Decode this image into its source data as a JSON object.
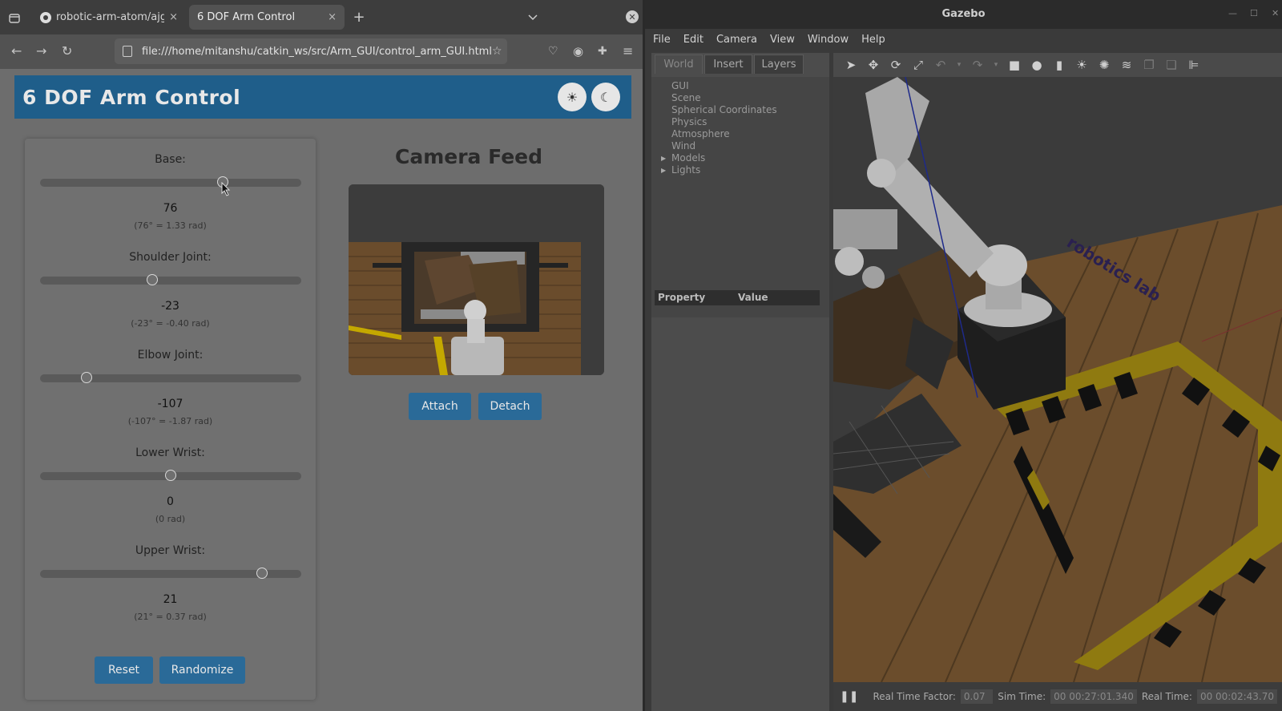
{
  "browser": {
    "tabs": [
      {
        "label": "robotic-arm-atom/ajgar_ros",
        "close": "×"
      },
      {
        "label": "6 DOF Arm Control",
        "close": "×"
      }
    ],
    "new_tab": "+",
    "url": "file:///home/mitanshu/catkin_ws/src/Arm_GUI/control_arm_GUI.html"
  },
  "app": {
    "title": "6 DOF Arm Control",
    "light_icon": "☀",
    "dark_icon": "☾",
    "joints": [
      {
        "label": "Base:",
        "value": "76",
        "rad": "(76° = 1.33 rad)",
        "fraction": 0.7
      },
      {
        "label": "Shoulder Joint:",
        "value": "-23",
        "rad": "(-23° = -0.40 rad)",
        "fraction": 0.43
      },
      {
        "label": "Elbow Joint:",
        "value": "-107",
        "rad": "(-107° = -1.87 rad)",
        "fraction": 0.18
      },
      {
        "label": "Lower Wrist:",
        "value": "0",
        "rad": "(0 rad)",
        "fraction": 0.5
      },
      {
        "label": "Upper Wrist:",
        "value": "21",
        "rad": "(21° = 0.37 rad)",
        "fraction": 0.85
      }
    ],
    "reset_label": "Reset",
    "randomize_label": "Randomize",
    "camera_title": "Camera Feed",
    "attach_label": "Attach",
    "detach_label": "Detach"
  },
  "gazebo": {
    "title": "Gazebo",
    "menu": [
      "File",
      "Edit",
      "Camera",
      "View",
      "Window",
      "Help"
    ],
    "tabs": [
      "World",
      "Insert",
      "Layers"
    ],
    "tree": [
      "GUI",
      "Scene",
      "Spherical Coordinates",
      "Physics",
      "Atmosphere",
      "Wind",
      "Models",
      "Lights"
    ],
    "property_header": "Property",
    "value_header": "Value",
    "status": {
      "rtf_label": "Real Time Factor:",
      "rtf_value": "0.07",
      "sim_label": "Sim Time:",
      "sim_value": "00 00:27:01.340",
      "real_label": "Real Time:",
      "real_value": "00 00:02:43.70"
    },
    "floor_text": "robotics lab"
  }
}
